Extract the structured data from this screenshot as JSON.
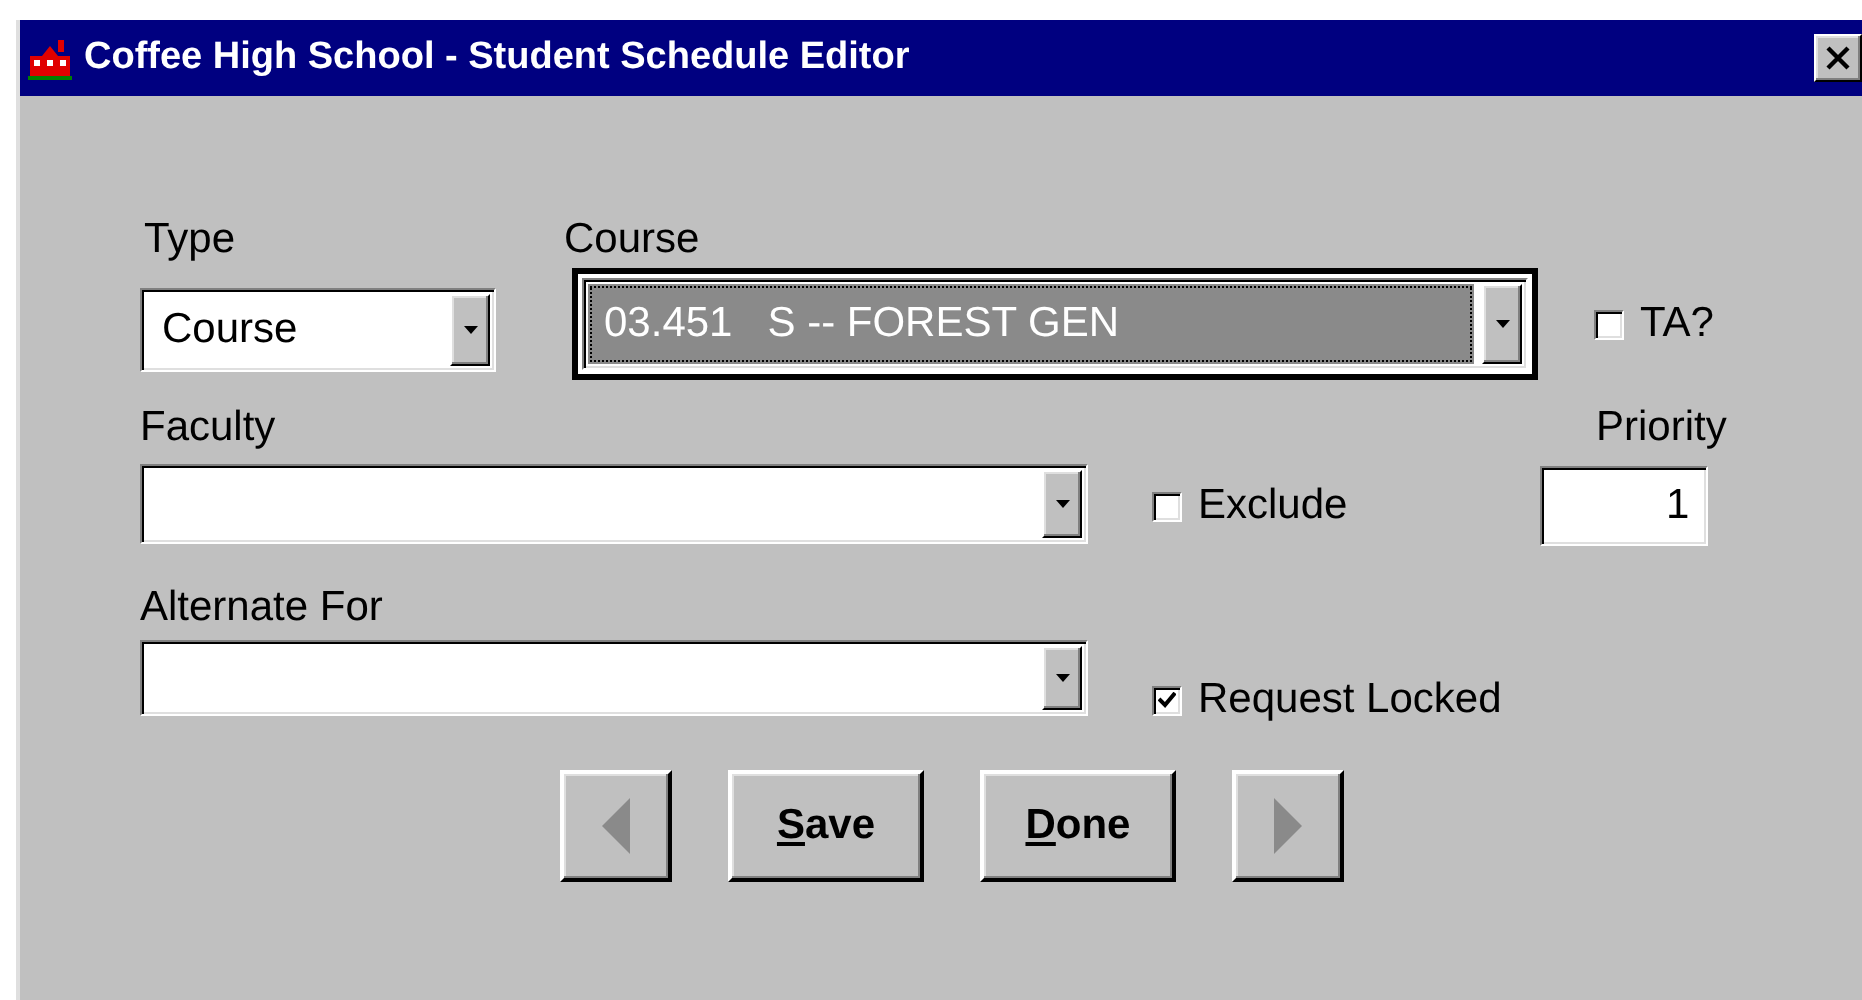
{
  "window": {
    "title": "Coffee High School - Student Schedule Editor"
  },
  "fields": {
    "type": {
      "label": "Type",
      "value": "Course"
    },
    "course": {
      "label": "Course",
      "value": "03.451   S -- FOREST GEN",
      "focused": true
    },
    "faculty": {
      "label": "Faculty"
    },
    "alternate_for": {
      "label": "Alternate For"
    },
    "priority": {
      "label": "Priority",
      "value": "1"
    }
  },
  "checkboxes": [
    {
      "label": "TA?",
      "checked": false
    },
    {
      "label": "Exclude",
      "checked": false
    },
    {
      "label": "Request Locked",
      "checked": true
    }
  ],
  "buttons": [
    {
      "kind": "previous",
      "disabled": true
    },
    {
      "kind": "text",
      "label": "Save"
    },
    {
      "kind": "text",
      "label": "Done"
    },
    {
      "kind": "next",
      "disabled": true
    }
  ]
}
